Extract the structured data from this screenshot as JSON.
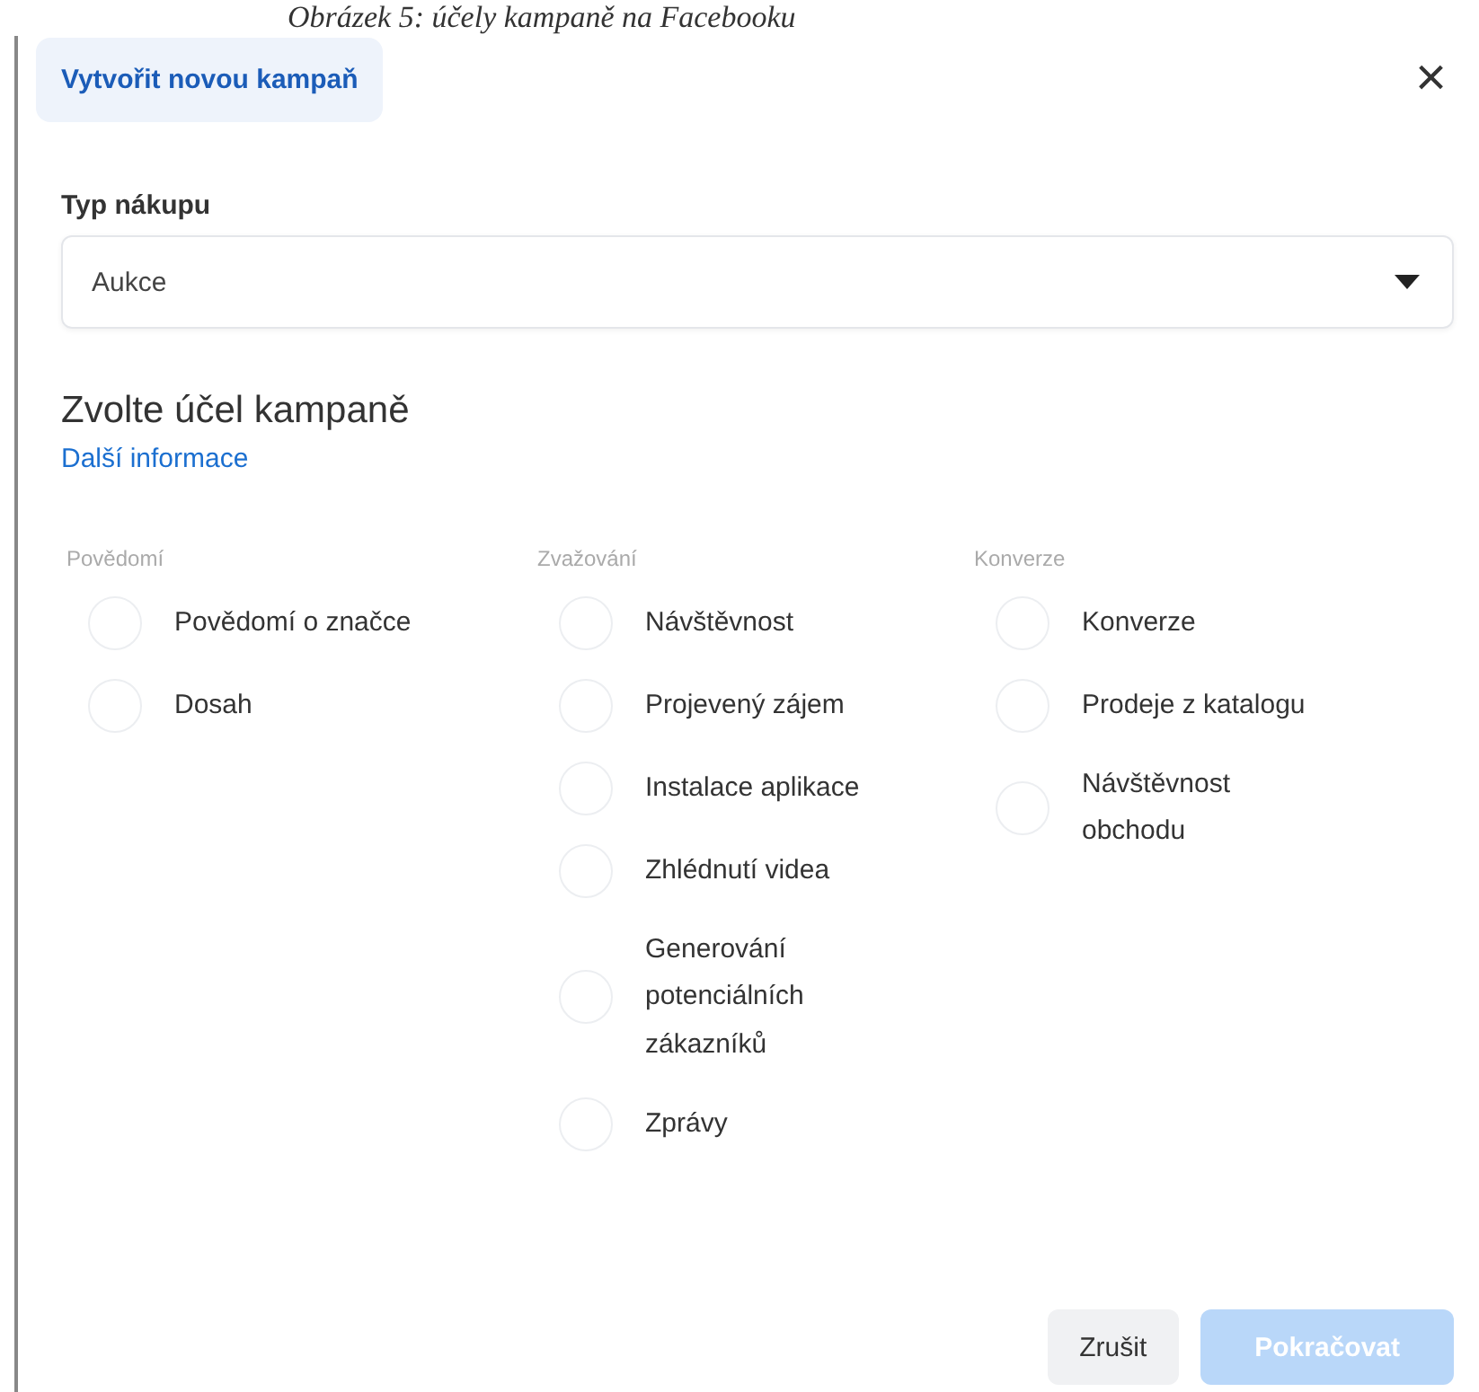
{
  "caption": "Obrázek 5: účely kampaně na Facebooku",
  "dialog": {
    "title": "Vytvořit novou kampaň",
    "close": "×",
    "purchase_type": {
      "label": "Typ nákupu",
      "value": "Aukce"
    },
    "heading": "Zvolte účel kampaně",
    "link": "Další informace",
    "columns": [
      {
        "title": "Povědomí",
        "options": [
          {
            "label": "Povědomí o značce",
            "selected": false
          },
          {
            "label": "Dosah",
            "selected": false
          }
        ]
      },
      {
        "title": "Zvažování",
        "options": [
          {
            "label": "Návštěvnost",
            "selected": false
          },
          {
            "label": "Projevený zájem",
            "selected": false
          },
          {
            "label": "Instalace aplikace",
            "selected": false
          },
          {
            "label": "Zhlédnutí videa",
            "selected": false
          },
          {
            "label": "Generování potenciálních zákazníků",
            "selected": false
          },
          {
            "label": "Zprávy",
            "selected": false
          }
        ]
      },
      {
        "title": "Konverze",
        "options": [
          {
            "label": "Konverze",
            "selected": false
          },
          {
            "label": "Prodeje z katalogu",
            "selected": false
          },
          {
            "label": "Návštěvnost obchodu",
            "selected": false
          }
        ]
      }
    ],
    "buttons": [
      {
        "label": "Zrušit",
        "kind": "secondary",
        "disabled": false
      },
      {
        "label": "Pokračovat",
        "kind": "primary",
        "disabled": true
      }
    ]
  }
}
